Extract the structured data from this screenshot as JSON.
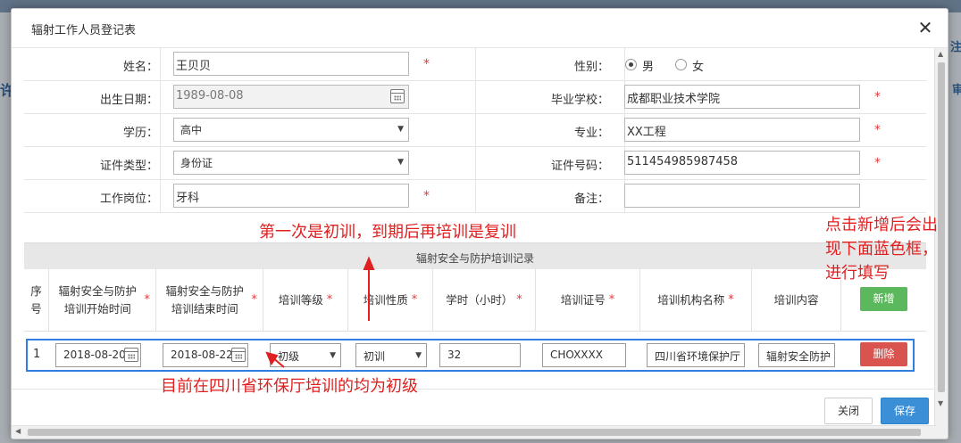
{
  "dialog": {
    "title": "辐射工作人员登记表",
    "close_icon": "close-icon"
  },
  "background": {
    "left_fragment": "许",
    "right_fragment": "注",
    "right_fragment2": "审"
  },
  "form": {
    "name": {
      "label": "姓名：",
      "value": "王贝贝",
      "required": "*"
    },
    "gender": {
      "label": "性别：",
      "options": [
        "男",
        "女"
      ],
      "selected": "男"
    },
    "birth": {
      "label": "出生日期：",
      "value": "1989-08-08"
    },
    "school": {
      "label": "毕业学校：",
      "value": "成都职业技术学院",
      "required": "*"
    },
    "education": {
      "label": "学历：",
      "value": "高中"
    },
    "major": {
      "label": "专业：",
      "value": "XX工程",
      "required": "*"
    },
    "id_type": {
      "label": "证件类型：",
      "value": "身份证"
    },
    "id_no": {
      "label": "证件号码：",
      "value": "511454985987458",
      "required": "*"
    },
    "position": {
      "label": "工作岗位：",
      "value": "牙科",
      "required": "*"
    },
    "remark": {
      "label": "备注：",
      "value": ""
    }
  },
  "training": {
    "section_title": "辐射安全与防护培训记录",
    "headers": {
      "seq": "序号",
      "start": "辐射安全与防护培训开始时间",
      "end": "辐射安全与防护培训结束时间",
      "level": "培训等级",
      "nature": "培训性质",
      "hours": "学时（小时）",
      "cert": "培训证号",
      "org": "培训机构名称",
      "content": "培训内容",
      "req": "*"
    },
    "add_button": "新增",
    "rows": [
      {
        "seq": "1",
        "start": "2018-08-20",
        "end": "2018-08-22",
        "level": "初级",
        "nature": "初训",
        "hours": "32",
        "cert": "CHOXXXX",
        "org": "四川省环境保护厅",
        "content": "辐射安全防护",
        "delete_button": "删除"
      }
    ]
  },
  "footer": {
    "close_button": "关闭",
    "save_button": "保存"
  },
  "annotations": {
    "top_note": "第一次是初训，到期后再培训是复训",
    "right_note_1": "点击新增后会出",
    "right_note_2": "现下面蓝色框，",
    "right_note_3": "进行填写",
    "bottom_note": "目前在四川省环保厅培训的均为初级"
  },
  "colors": {
    "accent_blue": "#2f7fe0",
    "required_red": "#e13c3c",
    "annotation_red": "#e02020",
    "add_green": "#5cb85c",
    "delete_red": "#d9534f",
    "save_blue": "#3a8fd6"
  }
}
